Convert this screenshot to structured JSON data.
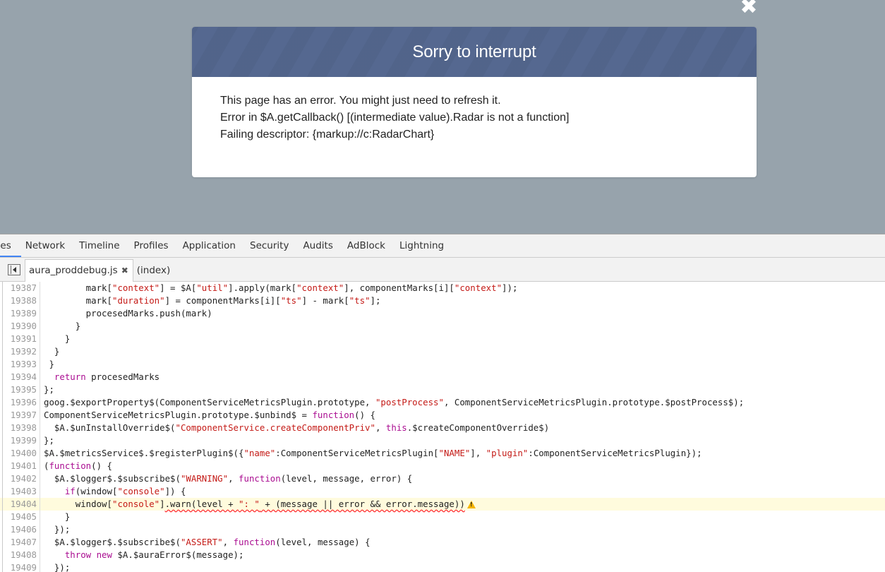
{
  "overlay": {
    "close_icon": "close-icon",
    "modal": {
      "title": "Sorry to interrupt",
      "messages": [
        "This page has an error. You might just need to refresh it.",
        "Error in $A.getCallback() [(intermediate value).Radar is not a function]",
        "Failing descriptor: {markup://c:RadarChart}"
      ],
      "header_color": "#556890"
    }
  },
  "devtools": {
    "main_tabs": [
      {
        "label": "ces",
        "active": true
      },
      {
        "label": "Network"
      },
      {
        "label": "Timeline"
      },
      {
        "label": "Profiles"
      },
      {
        "label": "Application"
      },
      {
        "label": "Security"
      },
      {
        "label": "Audits"
      },
      {
        "label": "AdBlock"
      },
      {
        "label": "Lightning"
      }
    ],
    "file_tabs": [
      {
        "label": "aura_proddebug.js",
        "active": true,
        "close_icon": "close-icon"
      },
      {
        "label": "(index)"
      }
    ],
    "sidebar_toggle_icon": "sidebar-toggle-icon",
    "highlighted_line": 19404,
    "warning_icon": "warning-triangle-icon",
    "code_lines": [
      {
        "n": "19387",
        "tokens": [
          [
            "p",
            "        mark["
          ],
          [
            "s",
            "\"context\""
          ],
          [
            "p",
            "] = $A["
          ],
          [
            "s",
            "\"util\""
          ],
          [
            "p",
            "].apply(mark["
          ],
          [
            "s",
            "\"context\""
          ],
          [
            "p",
            "], componentMarks[i]["
          ],
          [
            "s",
            "\"context\""
          ],
          [
            "p",
            "]);"
          ]
        ]
      },
      {
        "n": "19388",
        "tokens": [
          [
            "p",
            "        mark["
          ],
          [
            "s",
            "\"duration\""
          ],
          [
            "p",
            "] = componentMarks[i]["
          ],
          [
            "s",
            "\"ts\""
          ],
          [
            "p",
            "] - mark["
          ],
          [
            "s",
            "\"ts\""
          ],
          [
            "p",
            "];"
          ]
        ]
      },
      {
        "n": "19389",
        "tokens": [
          [
            "p",
            "        procesedMarks.push(mark)"
          ]
        ]
      },
      {
        "n": "19390",
        "tokens": [
          [
            "p",
            "      }"
          ]
        ]
      },
      {
        "n": "19391",
        "tokens": [
          [
            "p",
            "    }"
          ]
        ]
      },
      {
        "n": "19392",
        "tokens": [
          [
            "p",
            "  }"
          ]
        ]
      },
      {
        "n": "19393",
        "tokens": [
          [
            "p",
            " }"
          ]
        ]
      },
      {
        "n": "19394",
        "tokens": [
          [
            "p",
            "  "
          ],
          [
            "k",
            "return"
          ],
          [
            "p",
            " procesedMarks"
          ]
        ]
      },
      {
        "n": "19395",
        "tokens": [
          [
            "p",
            "};"
          ]
        ]
      },
      {
        "n": "19396",
        "tokens": [
          [
            "p",
            "goog.$exportProperty$(ComponentServiceMetricsPlugin.prototype, "
          ],
          [
            "s",
            "\"postProcess\""
          ],
          [
            "p",
            ", ComponentServiceMetricsPlugin.prototype.$postProcess$);"
          ]
        ]
      },
      {
        "n": "19397",
        "tokens": [
          [
            "p",
            "ComponentServiceMetricsPlugin.prototype.$unbind$ = "
          ],
          [
            "k",
            "function"
          ],
          [
            "p",
            "() {"
          ]
        ]
      },
      {
        "n": "19398",
        "tokens": [
          [
            "p",
            "  $A.$unInstallOverride$("
          ],
          [
            "s",
            "\"ComponentService.createComponentPriv\""
          ],
          [
            "p",
            ", "
          ],
          [
            "k",
            "this"
          ],
          [
            "p",
            ".$createComponentOverride$)"
          ]
        ]
      },
      {
        "n": "19399",
        "tokens": [
          [
            "p",
            "};"
          ]
        ]
      },
      {
        "n": "19400",
        "tokens": [
          [
            "p",
            "$A.$metricsService$.$registerPlugin$({"
          ],
          [
            "s",
            "\"name\""
          ],
          [
            "p",
            ":ComponentServiceMetricsPlugin["
          ],
          [
            "s",
            "\"NAME\""
          ],
          [
            "p",
            "], "
          ],
          [
            "s",
            "\"plugin\""
          ],
          [
            "p",
            ":ComponentServiceMetricsPlugin});"
          ]
        ]
      },
      {
        "n": "19401",
        "tokens": [
          [
            "p",
            "("
          ],
          [
            "k",
            "function"
          ],
          [
            "p",
            "() {"
          ]
        ]
      },
      {
        "n": "19402",
        "tokens": [
          [
            "p",
            "  $A.$logger$.$subscribe$("
          ],
          [
            "s",
            "\"WARNING\""
          ],
          [
            "p",
            ", "
          ],
          [
            "k",
            "function"
          ],
          [
            "p",
            "(level, message, error) {"
          ]
        ]
      },
      {
        "n": "19403",
        "tokens": [
          [
            "p",
            "    "
          ],
          [
            "k",
            "if"
          ],
          [
            "p",
            "(window["
          ],
          [
            "s",
            "\"console\""
          ],
          [
            "p",
            "]) {"
          ]
        ]
      },
      {
        "n": "19404",
        "tokens": [
          [
            "p",
            "      window["
          ],
          [
            "s",
            "\"console\""
          ],
          [
            "p",
            "]"
          ],
          [
            "w",
            ".warn(level + "
          ],
          [
            "ws",
            "\": \""
          ],
          [
            "w",
            " + (message || error && error.message))"
          ]
        ],
        "warning": true
      },
      {
        "n": "19405",
        "tokens": [
          [
            "p",
            "    }"
          ]
        ]
      },
      {
        "n": "19406",
        "tokens": [
          [
            "p",
            "  });"
          ]
        ]
      },
      {
        "n": "19407",
        "tokens": [
          [
            "p",
            "  $A.$logger$.$subscribe$("
          ],
          [
            "s",
            "\"ASSERT\""
          ],
          [
            "p",
            ", "
          ],
          [
            "k",
            "function"
          ],
          [
            "p",
            "(level, message) {"
          ]
        ]
      },
      {
        "n": "19408",
        "tokens": [
          [
            "p",
            "    "
          ],
          [
            "k",
            "throw new"
          ],
          [
            "p",
            " $A.$auraError$(message);"
          ]
        ]
      },
      {
        "n": "19409",
        "tokens": [
          [
            "p",
            "  });"
          ]
        ]
      }
    ]
  }
}
